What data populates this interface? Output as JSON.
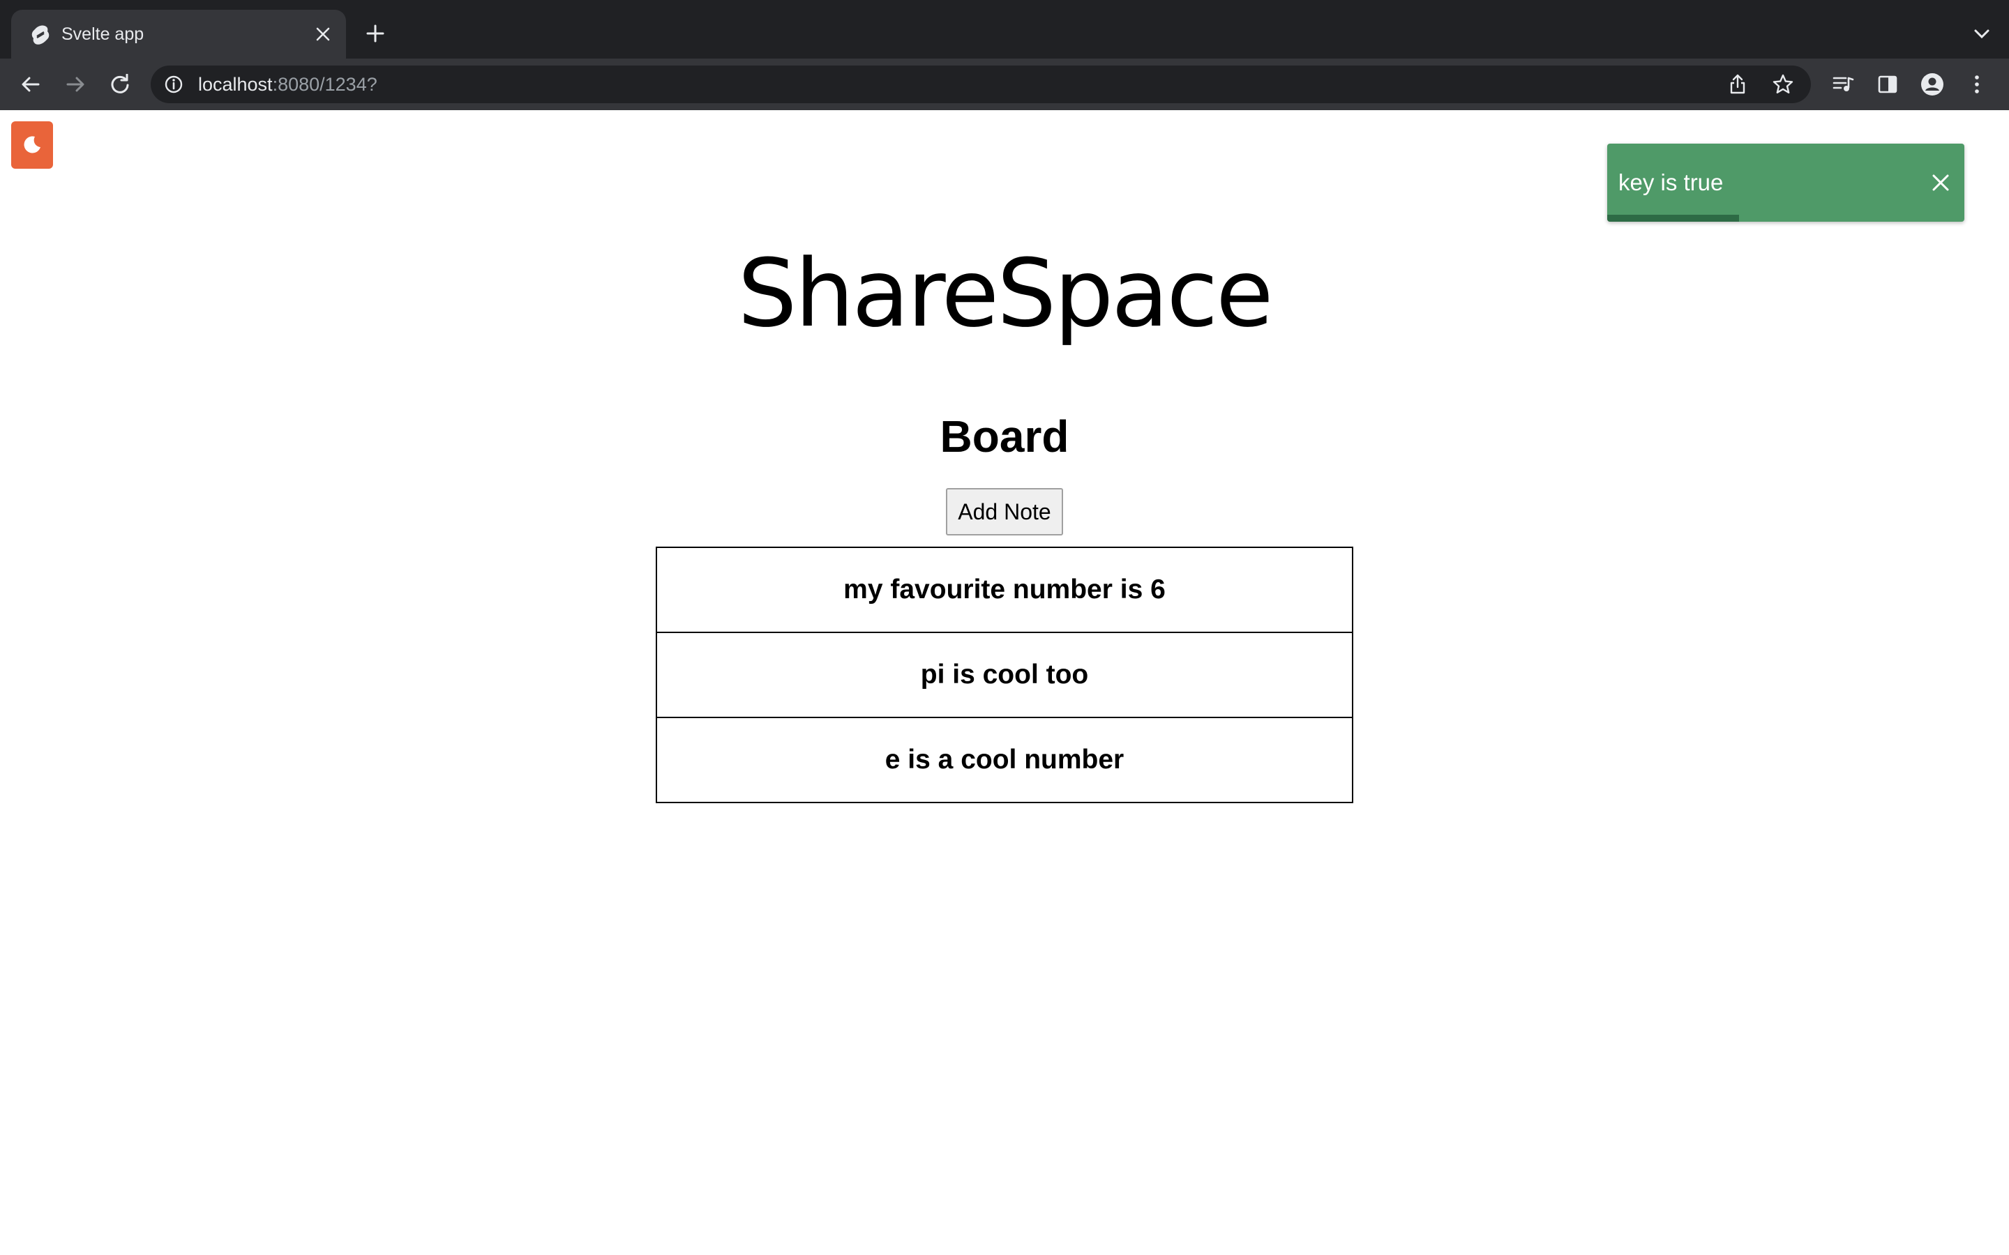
{
  "browser": {
    "tab": {
      "title": "Svelte app"
    },
    "address_bar": {
      "host": "localhost",
      "rest": ":8080/1234?"
    }
  },
  "page": {
    "toast": {
      "message": "key is true",
      "progress_fraction": 0.37,
      "background": "#4f9a68"
    },
    "theme_toggle": {
      "icon": "moon-icon",
      "color": "#e9643a"
    },
    "app_title": "ShareSpace",
    "board_heading": "Board",
    "add_note_label": "Add Note",
    "notes": [
      {
        "text": "my favourite number is 6"
      },
      {
        "text": "pi is cool too"
      },
      {
        "text": "e is a cool number"
      }
    ]
  }
}
